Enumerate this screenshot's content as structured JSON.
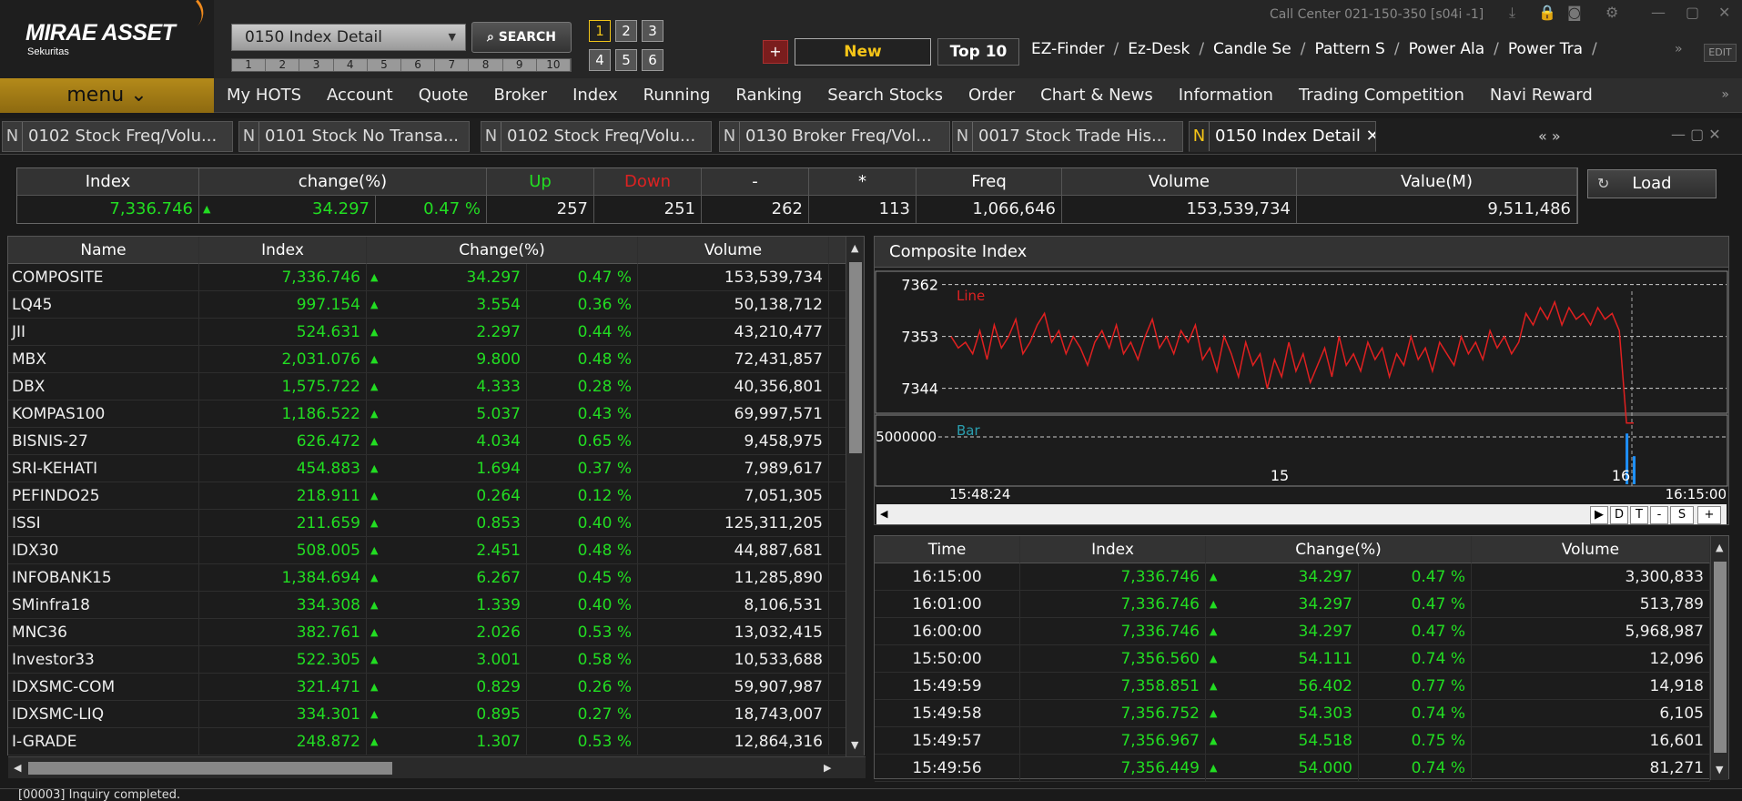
{
  "app": {
    "brand": "MIRAE ASSET",
    "brand_sub": "Sekuritas",
    "call_center": "Call Center 021-150-350 [s04i -1]"
  },
  "toolbar": {
    "screen_select": "0150  Index Detail",
    "screen_nums": [
      "1",
      "2",
      "3",
      "4",
      "5",
      "6",
      "7",
      "8",
      "9",
      "10"
    ],
    "search_label": "SEARCH",
    "screen_buttons": [
      "1",
      "2",
      "3",
      "4",
      "5",
      "6"
    ],
    "plus_label": "+",
    "new_label": "New",
    "top10_label": "Top 10",
    "shortcuts": [
      "EZ-Finder",
      "Ez-Desk",
      "Candle Se",
      "Pattern S",
      "Power Ala",
      "Power Tra"
    ],
    "edit_label": "EDIT"
  },
  "menu": {
    "button_label": "menu ⌄",
    "items": [
      "My HOTS",
      "Account",
      "Quote",
      "Broker",
      "Index",
      "Running",
      "Ranking",
      "Search Stocks",
      "Order",
      "Chart & News",
      "Information",
      "Trading Competition",
      "Navi Reward"
    ]
  },
  "tabs": [
    {
      "n": "N",
      "label": "0102 Stock Freq/Volu..."
    },
    {
      "n": "N",
      "label": "0101 Stock No Transa..."
    },
    {
      "n": "N",
      "label": "0102 Stock Freq/Volu..."
    },
    {
      "n": "N",
      "label": "0130 Broker Freq/Vol..."
    },
    {
      "n": "N",
      "label": "0017 Stock Trade His..."
    },
    {
      "n": "N",
      "label": "0150 Index Detail"
    }
  ],
  "summary": {
    "headers": {
      "index": "Index",
      "change": "change(%)",
      "up": "Up",
      "down": "Down",
      "flat": "-",
      "star": "*",
      "freq": "Freq",
      "volume": "Volume",
      "value": "Value(M)"
    },
    "values": {
      "index": "7,336.746",
      "change": "34.297",
      "pct": "0.47 %",
      "up": "257",
      "down": "251",
      "flat": "262",
      "star": "113",
      "freq": "1,066,646",
      "volume": "153,539,734",
      "value": "9,511,486"
    },
    "load_label": "Load"
  },
  "left_table": {
    "headers": [
      "Name",
      "Index",
      "Change(%)",
      "Volume"
    ],
    "rows": [
      [
        "COMPOSITE",
        "7,336.746",
        "34.297",
        "0.47 %",
        "153,539,734"
      ],
      [
        "LQ45",
        "997.154",
        "3.554",
        "0.36 %",
        "50,138,712"
      ],
      [
        "JII",
        "524.631",
        "2.297",
        "0.44 %",
        "43,210,477"
      ],
      [
        "MBX",
        "2,031.076",
        "9.800",
        "0.48 %",
        "72,431,857"
      ],
      [
        "DBX",
        "1,575.722",
        "4.333",
        "0.28 %",
        "40,356,801"
      ],
      [
        "KOMPAS100",
        "1,186.522",
        "5.037",
        "0.43 %",
        "69,997,571"
      ],
      [
        "BISNIS-27",
        "626.472",
        "4.034",
        "0.65 %",
        "9,458,975"
      ],
      [
        "SRI-KEHATI",
        "454.883",
        "1.694",
        "0.37 %",
        "7,989,617"
      ],
      [
        "PEFINDO25",
        "218.911",
        "0.264",
        "0.12 %",
        "7,051,305"
      ],
      [
        "ISSI",
        "211.659",
        "0.853",
        "0.40 %",
        "125,311,205"
      ],
      [
        "IDX30",
        "508.005",
        "2.451",
        "0.48 %",
        "44,887,681"
      ],
      [
        "INFOBANK15",
        "1,384.694",
        "6.267",
        "0.45 %",
        "11,285,890"
      ],
      [
        "SMinfra18",
        "334.308",
        "1.339",
        "0.40 %",
        "8,106,531"
      ],
      [
        "MNC36",
        "382.761",
        "2.026",
        "0.53 %",
        "13,032,415"
      ],
      [
        "Investor33",
        "522.305",
        "3.001",
        "0.58 %",
        "10,533,688"
      ],
      [
        "IDXSMC-COM",
        "321.471",
        "0.829",
        "0.26 %",
        "59,907,987"
      ],
      [
        "IDXSMC-LIQ",
        "334.301",
        "0.895",
        "0.27 %",
        "18,743,007"
      ],
      [
        "I-GRADE",
        "248.872",
        "1.307",
        "0.53 %",
        "12,864,316"
      ]
    ]
  },
  "chart": {
    "title": "Composite Index",
    "line_label": "Line",
    "bar_label": "Bar",
    "y_ticks": [
      "7362",
      "7353",
      "7344"
    ],
    "bar_tick": "5000000",
    "x_ticks": [
      "15",
      "16"
    ],
    "time_start": "15:48:24",
    "time_end": "16:15:00",
    "buttons": [
      "D",
      "T",
      "-",
      "S",
      "+"
    ]
  },
  "chart_data": {
    "type": "line",
    "title": "Composite Index",
    "x_range": [
      "15:48:24",
      "16:15:00"
    ],
    "ylim": [
      7340,
      7364
    ],
    "y_ticks": [
      7344,
      7353,
      7362
    ],
    "series": [
      {
        "name": "Line",
        "color": "#e02020",
        "values": [
          7353,
          7351,
          7352,
          7350,
          7354,
          7349,
          7355,
          7351,
          7353,
          7356,
          7350,
          7352,
          7355,
          7357,
          7352,
          7354,
          7350,
          7353,
          7351,
          7348,
          7352,
          7354,
          7351,
          7355,
          7350,
          7352,
          7349,
          7353,
          7356,
          7351,
          7353,
          7350,
          7354,
          7352,
          7355,
          7349,
          7351,
          7347,
          7353,
          7350,
          7346,
          7352,
          7348,
          7350,
          7344,
          7349,
          7346,
          7352,
          7347,
          7350,
          7345,
          7348,
          7351,
          7346,
          7353,
          7348,
          7350,
          7347,
          7352,
          7349,
          7351,
          7346,
          7350,
          7348,
          7353,
          7349,
          7351,
          7347,
          7352,
          7350,
          7348,
          7353,
          7350,
          7352,
          7349,
          7354,
          7351,
          7353,
          7350,
          7352,
          7357,
          7355,
          7358,
          7356,
          7359,
          7355,
          7358,
          7356,
          7357,
          7355,
          7358,
          7356,
          7357,
          7354,
          7338,
          7338
        ]
      }
    ],
    "bar_series": {
      "name": "Bar",
      "color": "#1e90ff",
      "values": [
        0,
        0,
        0,
        0,
        0,
        0,
        0,
        0,
        0,
        0,
        0,
        0,
        0,
        0,
        0,
        0,
        0,
        0,
        0,
        0,
        0,
        0,
        0,
        0,
        0,
        0,
        0,
        0,
        0,
        0,
        0,
        0,
        0,
        0,
        0,
        0,
        0,
        0,
        0,
        0,
        0,
        0,
        0,
        0,
        0,
        0,
        0,
        0,
        0,
        0,
        0,
        0,
        0,
        0,
        0,
        0,
        0,
        0,
        0,
        0,
        0,
        0,
        0,
        0,
        0,
        0,
        0,
        0,
        0,
        0,
        0,
        0,
        0,
        0,
        0,
        0,
        0,
        0,
        0,
        0,
        0,
        0,
        0,
        0,
        0,
        0,
        0,
        0,
        0,
        0,
        0,
        0,
        0,
        0,
        5968987,
        3300833
      ]
    }
  },
  "right_table": {
    "headers": [
      "Time",
      "Index",
      "Change(%)",
      "Volume"
    ],
    "rows": [
      [
        "16:15:00",
        "7,336.746",
        "34.297",
        "0.47 %",
        "3,300,833"
      ],
      [
        "16:01:00",
        "7,336.746",
        "34.297",
        "0.47 %",
        "513,789"
      ],
      [
        "16:00:00",
        "7,336.746",
        "34.297",
        "0.47 %",
        "5,968,987"
      ],
      [
        "15:50:00",
        "7,356.560",
        "54.111",
        "0.74 %",
        "12,096"
      ],
      [
        "15:49:59",
        "7,358.851",
        "56.402",
        "0.77 %",
        "14,918"
      ],
      [
        "15:49:58",
        "7,356.752",
        "54.303",
        "0.74 %",
        "6,105"
      ],
      [
        "15:49:57",
        "7,356.967",
        "54.518",
        "0.75 %",
        "16,601"
      ],
      [
        "15:49:56",
        "7,356.449",
        "54.000",
        "0.74 %",
        "81,271"
      ]
    ]
  },
  "status": {
    "message": "[00003] Inquiry completed."
  },
  "colors": {
    "up": "#22dd22",
    "down": "#dd2222",
    "accent": "#f5c518",
    "menu": "#b48a1a"
  }
}
